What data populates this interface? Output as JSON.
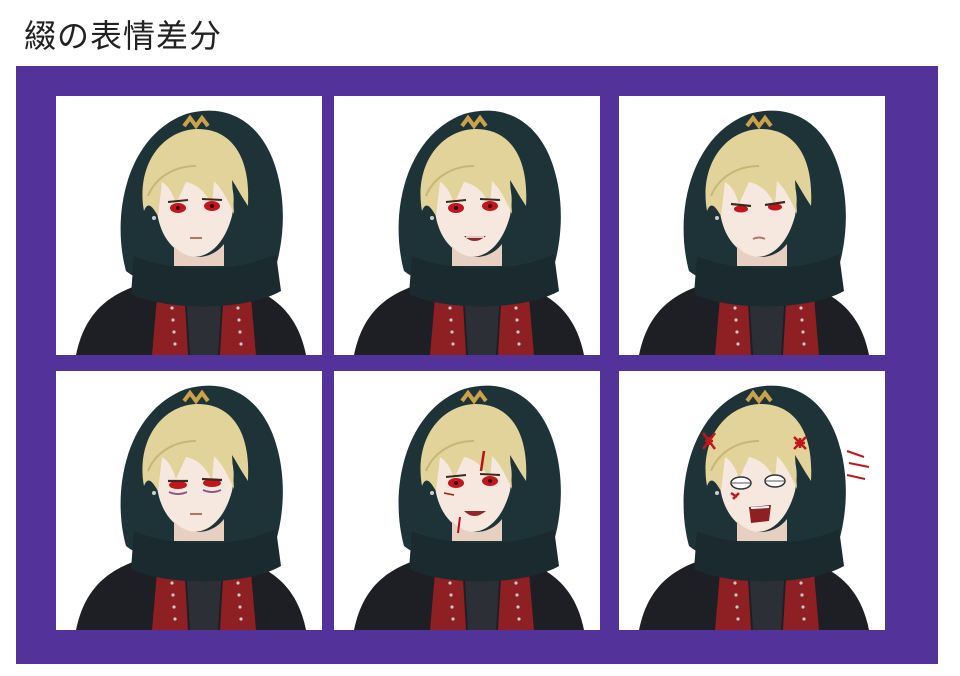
{
  "page": {
    "title": "綴の表情差分"
  },
  "colors": {
    "frame": "#53339a",
    "hood": "#1e3338",
    "hair": "#e2d39a",
    "jacket_red": "#8e1f22",
    "coat": "#1d1f25",
    "eyes": "#c0161c",
    "anger_mark": "#c0161c"
  },
  "panels": [
    {
      "expression": "neutral"
    },
    {
      "expression": "smirk"
    },
    {
      "expression": "displeased"
    },
    {
      "expression": "tired"
    },
    {
      "expression": "injured-smile"
    },
    {
      "expression": "angry-shouting"
    }
  ]
}
